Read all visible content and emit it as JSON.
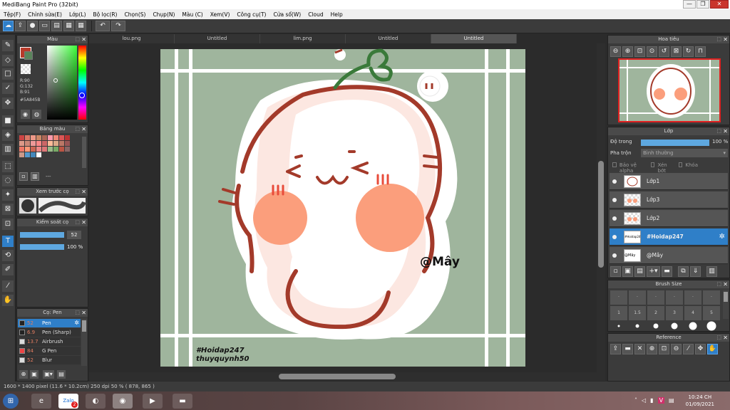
{
  "window": {
    "title": "MediBang Paint Pro (32bit)",
    "minimize": "—",
    "maximize": "❐",
    "close": "✕"
  },
  "menu": [
    "Tệp(F)",
    "Chỉnh sửa(E)",
    "Lớp(L)",
    "Bộ lọc(R)",
    "Chọn(S)",
    "Chụp(N)",
    "Màu (C)",
    "Xem(V)",
    "Công cụ(T)",
    "Cửa sổ(W)",
    "Cloud",
    "Help"
  ],
  "tabs": [
    {
      "label": "lou.png",
      "active": false
    },
    {
      "label": "Untitled",
      "active": false
    },
    {
      "label": "lim.png",
      "active": false
    },
    {
      "label": "Untitled",
      "active": false
    },
    {
      "label": "Untitled",
      "active": true
    }
  ],
  "color_panel": {
    "title": "Màu",
    "rgb": {
      "r": "R:90",
      "g": "G:132",
      "b": "B:91"
    },
    "hex": "#5A845B",
    "fg_color": "#b73a2a",
    "bg_color": "#5a845b"
  },
  "palette_panel": {
    "title": "Bảng màu",
    "add_label": "---"
  },
  "brush_preview_panel": {
    "title": "Xem trước cọ"
  },
  "brush_control_panel": {
    "title": "Kiểm soát cọ",
    "size_value": "52",
    "opacity_value": "100 %"
  },
  "brush_list_panel": {
    "title": "Cọ: Pen",
    "items": [
      {
        "size": "52",
        "name": "Pen",
        "selected": true
      },
      {
        "size": "6.9",
        "name": "Pen (Sharp)",
        "selected": false
      },
      {
        "size": "13.7",
        "name": "Airbrush",
        "selected": false
      },
      {
        "size": "84",
        "name": "G Pen",
        "selected": false
      },
      {
        "size": "52",
        "name": "Blur",
        "selected": false
      }
    ]
  },
  "navigator_panel": {
    "title": "Hoa tiêu"
  },
  "layer_panel": {
    "title": "Lớp",
    "opacity_label": "Độ trong",
    "opacity_value": "100 %",
    "blend_label": "Pha trộn",
    "blend_value": "Bình thường",
    "protect_alpha": "Bảo vệ alpha",
    "clipping": "Xén bớt",
    "lock": "Khóa",
    "layers": [
      {
        "name": "Lớp1",
        "selected": false,
        "thumb": ""
      },
      {
        "name": "Lớp3",
        "selected": false,
        "thumb": ""
      },
      {
        "name": "Lớp2",
        "selected": false,
        "thumb": ""
      },
      {
        "name": "#Hoidap247",
        "selected": true,
        "thumb": "#Hoidap247"
      },
      {
        "name": "@Mây",
        "selected": false,
        "thumb": "@Mây"
      }
    ]
  },
  "brush_size_panel": {
    "title": "Brush Size",
    "sizes_row1": [
      ".",
      ".",
      ".",
      ".",
      ".",
      "."
    ],
    "sizes_row2": [
      "1",
      "1.5",
      "2",
      "3",
      "4",
      "5"
    ]
  },
  "reference_panel": {
    "title": "Reference"
  },
  "canvas": {
    "watermark_line1": "#Hoidap247",
    "watermark_line2": "thuyquynh50",
    "signature": "@Mây",
    "bg_color": "#9fb59d"
  },
  "status": {
    "text": "1600 * 1400 pixel   (11.6 * 10.2cm)   250 dpi   50 %   ( 878, 865 )"
  },
  "taskbar": {
    "time": "10:24 CH",
    "date": "01/09/2021",
    "zalo_badge": "2"
  }
}
